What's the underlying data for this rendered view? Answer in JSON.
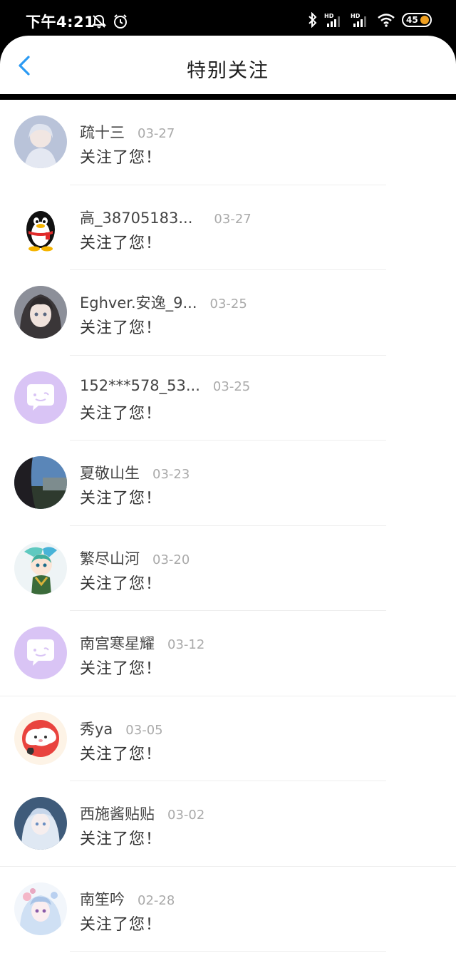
{
  "status_bar": {
    "time": "下午4:21",
    "battery": "45"
  },
  "header": {
    "title": "特别关注"
  },
  "list": [
    {
      "name": "疏十三",
      "date": "03-27",
      "message": "关注了您！",
      "avatar": "anime-girl-white"
    },
    {
      "name": "高_38705183...",
      "date": "03-27",
      "message": "关注了您！",
      "avatar": "qq-penguin"
    },
    {
      "name": "Eghver.安逸_9...",
      "date": "03-25",
      "message": "关注了您！",
      "avatar": "anime-girl-dark"
    },
    {
      "name": "152***578_53...",
      "date": "03-25",
      "message": "关注了您！",
      "avatar": "default-chat-purple"
    },
    {
      "name": "夏敬山生",
      "date": "03-23",
      "message": "关注了您！",
      "avatar": "photo-landscape"
    },
    {
      "name": "繁尽山河",
      "date": "03-20",
      "message": "关注了您！",
      "avatar": "chibi-character"
    },
    {
      "name": "南宫寒星耀",
      "date": "03-12",
      "message": "关注了您！",
      "avatar": "default-chat-purple"
    },
    {
      "name": "秀ya",
      "date": "03-05",
      "message": "关注了您！",
      "avatar": "cartoon-red"
    },
    {
      "name": "西施酱贴贴",
      "date": "03-02",
      "message": "关注了您！",
      "avatar": "anime-girl-blue"
    },
    {
      "name": "南笙吟",
      "date": "02-28",
      "message": "关注了您！",
      "avatar": "anime-girl-flowers"
    }
  ],
  "colors": {
    "accent": "#2b9af3",
    "default_avatar": "#d9c4f5"
  }
}
